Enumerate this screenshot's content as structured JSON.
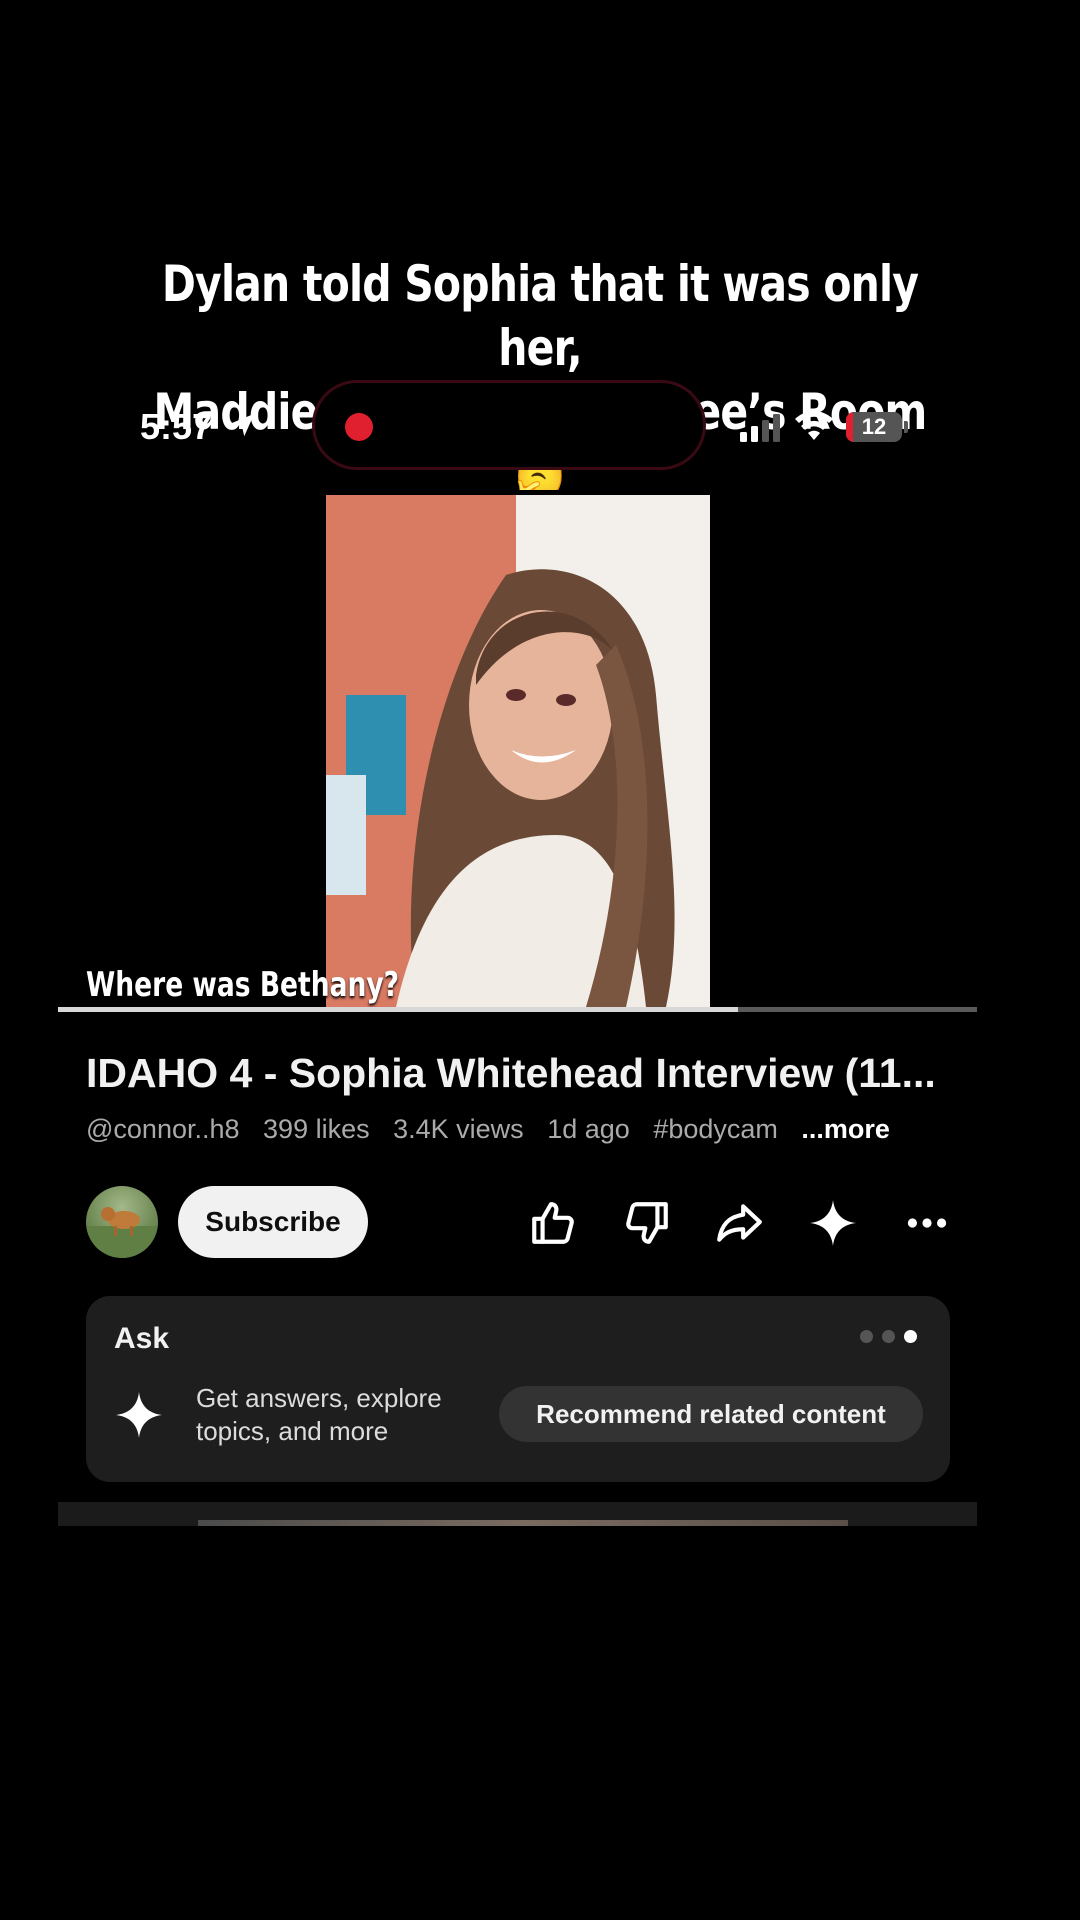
{
  "overlay": {
    "caption_line1": "Dylan told Sophia that it was only her,",
    "caption_line2": "Maddie & Kaylee in Kaylee’s Room 🤔",
    "subtitle": "Where was Bethany?"
  },
  "status_bar": {
    "time": "5:57",
    "battery_level": "12",
    "battery_fraction": 0.12,
    "recording_color": "#e0202e"
  },
  "video": {
    "progress_fraction": 0.74,
    "title": "IDAHO 4 - Sophia Whitehead Interview (11...",
    "channel": "@connor..h8",
    "likes": "399 likes",
    "views": "3.4K views",
    "age": "1d ago",
    "tag": "#bodycam",
    "more": "...more"
  },
  "actions": {
    "subscribe": "Subscribe",
    "icons": [
      "thumbs-up-icon",
      "thumbs-down-icon",
      "share-icon",
      "sparkle-icon",
      "more-icon"
    ]
  },
  "ask": {
    "title": "Ask",
    "description": "Get answers, explore topics, and more",
    "chip": "Recommend related content",
    "active_page": 3,
    "pages": 3
  },
  "colors": {
    "background": "#000000",
    "card": "#1e1e1e",
    "accent_red": "#e0202e"
  }
}
